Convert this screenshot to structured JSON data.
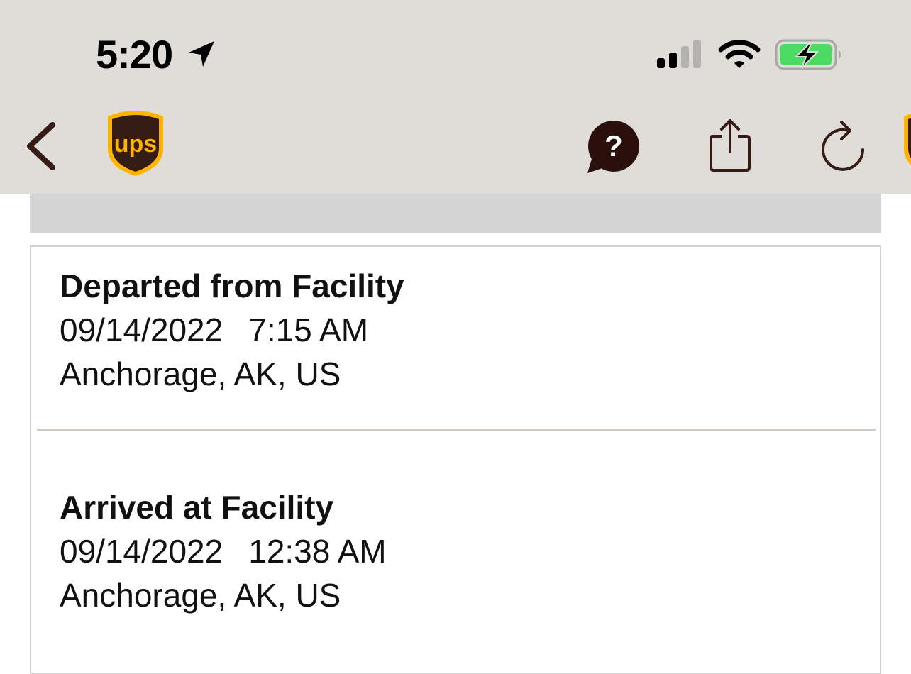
{
  "status_bar": {
    "time": "5:20",
    "icons": [
      "location-arrow-icon",
      "cellular-signal-icon",
      "wifi-icon",
      "battery-charging-icon"
    ],
    "battery_color": "#4cd964"
  },
  "nav_bar": {
    "icons": [
      "back-chevron-icon",
      "ups-logo",
      "help-chat-icon",
      "share-icon",
      "refresh-icon",
      "ups-shield-icon"
    ],
    "brand_color": "#351c15",
    "accent_color": "#ffb500",
    "logo_text": "ups"
  },
  "tracking_events": [
    {
      "status": "Departed from Facility",
      "date": "09/14/2022",
      "time": "7:15 AM",
      "location": "Anchorage, AK, US"
    },
    {
      "status": "Arrived at Facility",
      "date": "09/14/2022",
      "time": "12:38 AM",
      "location": "Anchorage, AK, US"
    }
  ]
}
